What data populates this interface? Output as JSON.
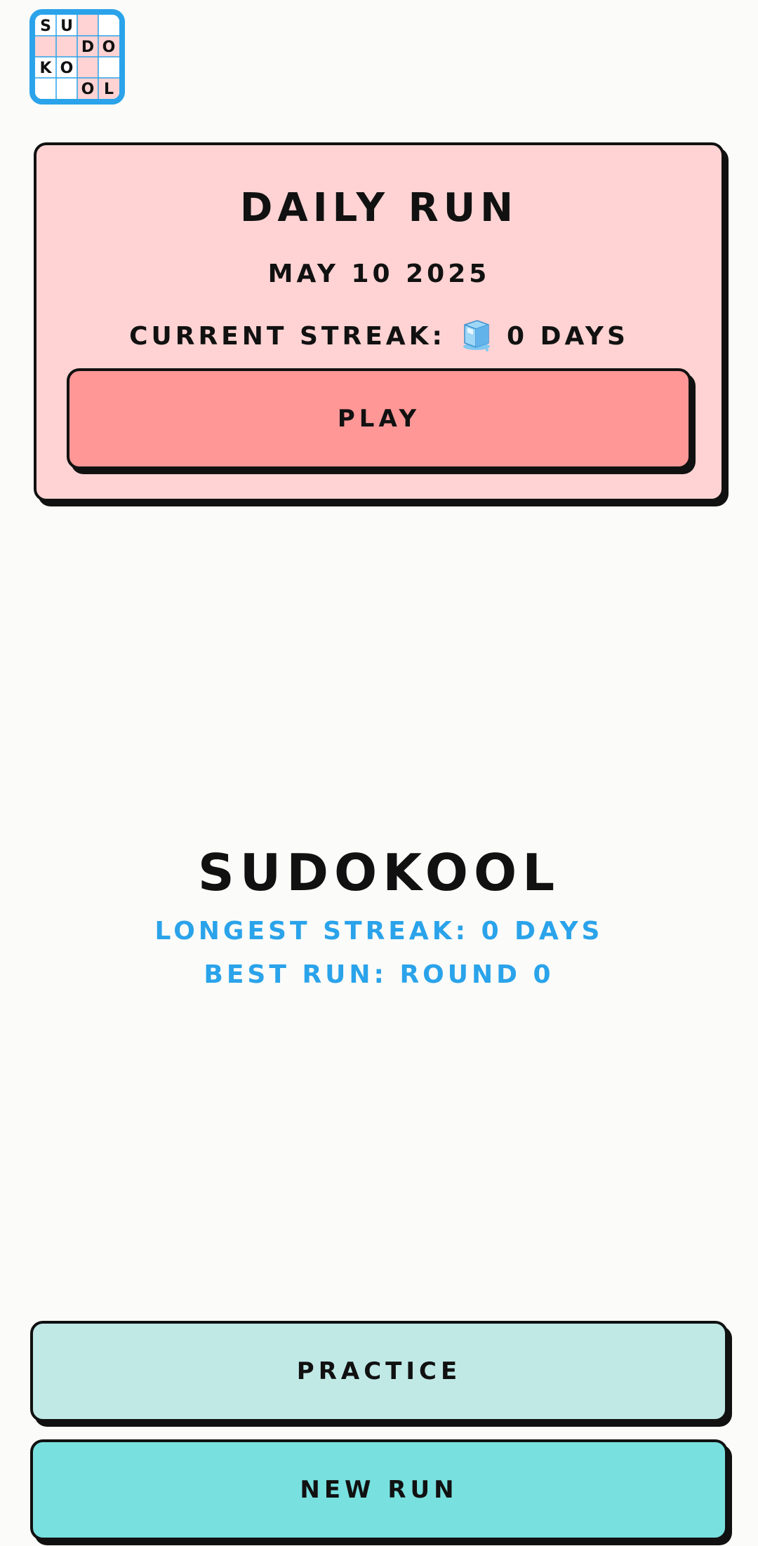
{
  "app": {
    "logo_letters": [
      "S",
      "U",
      "D",
      "O",
      "K",
      "O",
      "O",
      "L"
    ]
  },
  "daily": {
    "title": "DAILY RUN",
    "date": "MAY 10 2025",
    "streak_label": "CURRENT STREAK:",
    "streak_icon": "ice-cube-icon",
    "streak_value": "0 DAYS",
    "play_label": "PLAY"
  },
  "brand": {
    "name": "SUDOKOOL",
    "longest_streak": "LONGEST STREAK: 0 DAYS",
    "best_run": "BEST RUN: ROUND 0"
  },
  "actions": {
    "practice_label": "PRACTICE",
    "new_run_label": "NEW RUN"
  },
  "colors": {
    "accent_blue": "#2aa3ea",
    "card_pink": "#ffd3d3",
    "play_red": "#ff9797",
    "practice_teal": "#c0e9e6",
    "new_run_teal": "#78e1df"
  }
}
